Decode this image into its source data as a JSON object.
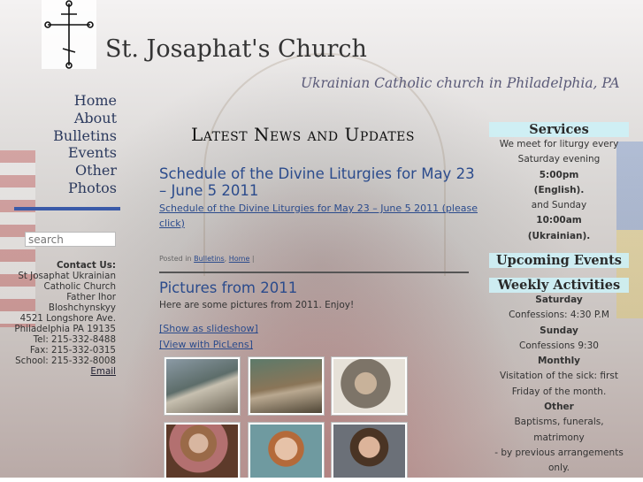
{
  "site": {
    "title": "St. Josaphat's Church",
    "tagline": "Ukrainian Catholic church in Philadelphia, PA"
  },
  "nav": {
    "items": [
      {
        "label": "Home"
      },
      {
        "label": "About"
      },
      {
        "label": "Bulletins"
      },
      {
        "label": "Events"
      },
      {
        "label": "Other"
      },
      {
        "label": "Photos"
      }
    ]
  },
  "search": {
    "placeholder": "search"
  },
  "contact": {
    "heading": "Contact Us:",
    "lines": [
      "St Josaphat Ukrainian",
      "Catholic Church",
      "Father Ihor",
      "Bloshchynskyy",
      "4521 Longshore Ave.",
      "Philadelphia PA 19135",
      "Tel: 215-332-8488",
      "Fax: 215-332-0315",
      "School: 215-332-8008"
    ],
    "email_label": "Email"
  },
  "main": {
    "section_title": "Latest News and Updates",
    "post1": {
      "title": "Schedule of the Divine Liturgies for May 23 – June 5 2011",
      "link": "Schedule of the Divine Liturgies for May 23 – June 5 2011 (please click)",
      "meta_prefix": "Posted in",
      "meta_cat1": "Bulletins",
      "meta_sep": ",",
      "meta_cat2": "Home",
      "meta_suffix": "|"
    },
    "post2": {
      "title": "Pictures from 2011",
      "text": "Here are some pictures from 2011. Enjoy!",
      "slideshow_link": "[Show as slideshow]",
      "piclens_link": "[View with PicLens]"
    }
  },
  "sidebar": {
    "services": {
      "heading": "Services",
      "lines": [
        {
          "text": "We meet for liturgy every",
          "bold": false
        },
        {
          "text": "Saturday evening",
          "bold": false
        },
        {
          "text": "5:00pm",
          "bold": true
        },
        {
          "text": "(English).",
          "bold": true
        },
        {
          "text": "and Sunday",
          "bold": false
        },
        {
          "text": "10:00am",
          "bold": true
        },
        {
          "text": "(Ukrainian).",
          "bold": true
        }
      ]
    },
    "upcoming": {
      "heading": "Upcoming Events"
    },
    "weekly": {
      "heading": "Weekly Activities",
      "lines": [
        {
          "text": "Saturday",
          "bold": true
        },
        {
          "text": "Confessions: 4:30 P.M",
          "bold": false
        },
        {
          "text": "Sunday",
          "bold": true
        },
        {
          "text": "Confessions 9:30",
          "bold": false
        },
        {
          "text": "Monthly",
          "bold": true
        },
        {
          "text": "Visitation of the sick: first",
          "bold": false
        },
        {
          "text": "Friday of the month.",
          "bold": false
        },
        {
          "text": "Other",
          "bold": true
        },
        {
          "text": "Baptisms, funerals, matrimony",
          "bold": false
        },
        {
          "text": "- by previous arrangements",
          "bold": false
        },
        {
          "text": "only.",
          "bold": false
        }
      ]
    }
  }
}
